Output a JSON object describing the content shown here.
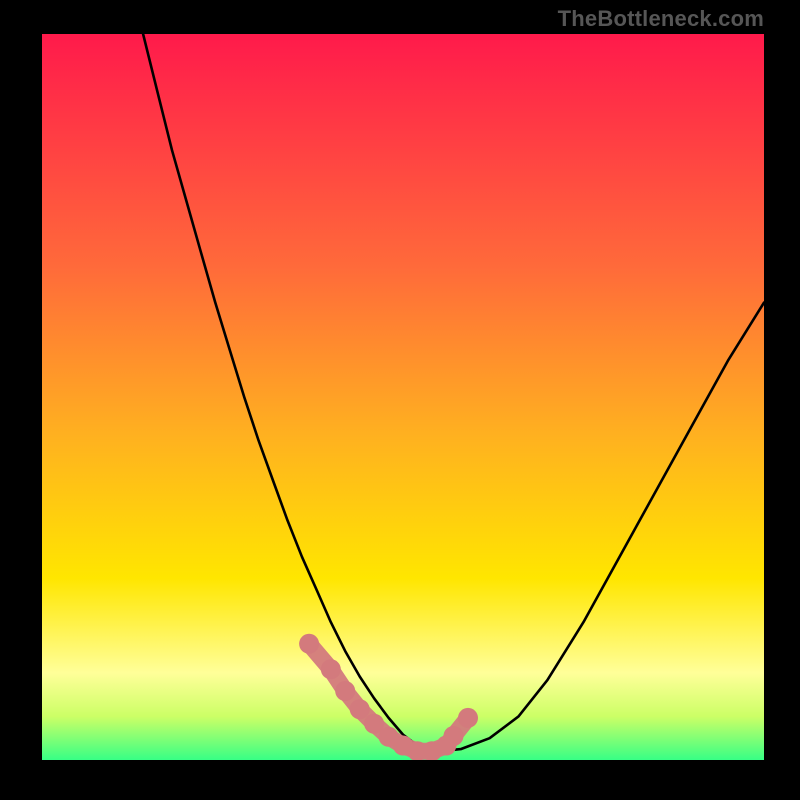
{
  "watermark": "TheBottleneck.com",
  "colors": {
    "top": "#ff1a4b",
    "mid_red_orange": "#ff6a3a",
    "mid_orange": "#ffb020",
    "mid_yellow": "#ffe600",
    "pale_yellow": "#ffff99",
    "yellow_green": "#ccff66",
    "spring_green": "#37ff85",
    "marker": "#d37a7d",
    "curve": "#000000",
    "frame": "#000000"
  },
  "chart_data": {
    "type": "line",
    "title": "",
    "xlabel": "",
    "ylabel": "",
    "xlim": [
      0,
      100
    ],
    "ylim": [
      0,
      100
    ],
    "series": [
      {
        "name": "bottleneck-curve",
        "x": [
          14,
          16,
          18,
          20,
          22,
          24,
          26,
          28,
          30,
          32,
          34,
          36,
          38,
          40,
          42,
          44,
          46,
          48,
          50,
          52,
          55,
          58,
          62,
          66,
          70,
          75,
          80,
          85,
          90,
          95,
          100
        ],
        "y": [
          100,
          92,
          84,
          77,
          70,
          63,
          56.5,
          50,
          44,
          38.5,
          33,
          28,
          23.5,
          19,
          15,
          11.5,
          8.5,
          5.8,
          3.5,
          2,
          1.2,
          1.5,
          3,
          6,
          11,
          19,
          28,
          37,
          46,
          55,
          63
        ]
      }
    ],
    "markers": {
      "name": "highlighted-points",
      "x": [
        37,
        40,
        42,
        44,
        46,
        48,
        50,
        52,
        54,
        56,
        57,
        59
      ],
      "y": [
        16,
        12.5,
        9.5,
        7,
        5,
        3.2,
        2,
        1.2,
        1.2,
        2,
        3.3,
        5.8
      ]
    },
    "gradient_stops": [
      {
        "offset": 0.0,
        "key": "top"
      },
      {
        "offset": 0.32,
        "key": "mid_red_orange"
      },
      {
        "offset": 0.55,
        "key": "mid_orange"
      },
      {
        "offset": 0.75,
        "key": "mid_yellow"
      },
      {
        "offset": 0.88,
        "key": "pale_yellow"
      },
      {
        "offset": 0.94,
        "key": "yellow_green"
      },
      {
        "offset": 1.0,
        "key": "spring_green"
      }
    ]
  }
}
